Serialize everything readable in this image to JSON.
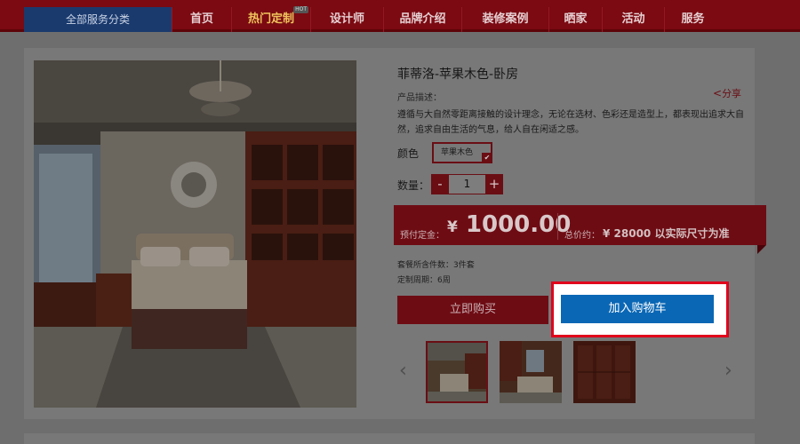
{
  "nav": {
    "all_categories": "全部服务分类",
    "items": [
      {
        "label": "首页"
      },
      {
        "label": "热门定制",
        "badge": "HOT"
      },
      {
        "label": "设计师"
      },
      {
        "label": "品牌介绍"
      },
      {
        "label": "装修案例"
      },
      {
        "label": "晒家"
      },
      {
        "label": "活动"
      },
      {
        "label": "服务"
      }
    ]
  },
  "product": {
    "title": "菲蒂洛-苹果木色-卧房",
    "desc_label": "产品描述：",
    "share_label": "分享",
    "description": "遵循与大自然零距离接触的设计理念，无论在选材、色彩还是造型上，都表现出追求大自然，追求自由生活的气息，给人自在闲适之感。",
    "color_label": "颜色",
    "color_value": "苹果木色",
    "qty_label": "数量：",
    "qty_minus": "-",
    "qty_value": "1",
    "qty_plus": "+",
    "deposit_label": "预付定金：",
    "deposit_currency": "¥",
    "deposit_value": "1000.00",
    "total_label": "总价约：",
    "total_value": "¥ 28000 以实际尺寸为准",
    "pieces": "套餐所含件数：3件套",
    "cycle": "定制周期：6周",
    "buy_now": "立即购买",
    "add_to_cart": "加入购物车"
  },
  "gallery": {
    "prev": "‹",
    "next": "›",
    "selected_index": 0,
    "thumb_count": 3
  },
  "colors": {
    "nav_bg": "#7b0a12",
    "accent_red": "#6e0c14",
    "cart_blue": "#0a67b5",
    "highlight_red": "#e1001c"
  }
}
